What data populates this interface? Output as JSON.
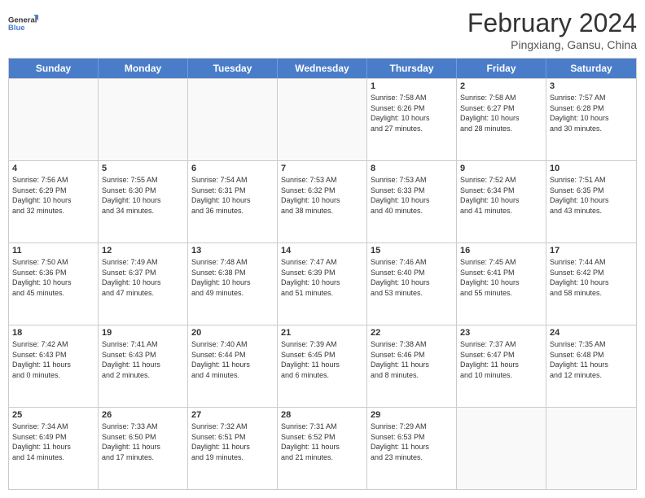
{
  "logo": {
    "line1": "General",
    "line2": "Blue"
  },
  "title": "February 2024",
  "subtitle": "Pingxiang, Gansu, China",
  "headers": [
    "Sunday",
    "Monday",
    "Tuesday",
    "Wednesday",
    "Thursday",
    "Friday",
    "Saturday"
  ],
  "weeks": [
    [
      {
        "day": "",
        "info": ""
      },
      {
        "day": "",
        "info": ""
      },
      {
        "day": "",
        "info": ""
      },
      {
        "day": "",
        "info": ""
      },
      {
        "day": "1",
        "info": "Sunrise: 7:58 AM\nSunset: 6:26 PM\nDaylight: 10 hours\nand 27 minutes."
      },
      {
        "day": "2",
        "info": "Sunrise: 7:58 AM\nSunset: 6:27 PM\nDaylight: 10 hours\nand 28 minutes."
      },
      {
        "day": "3",
        "info": "Sunrise: 7:57 AM\nSunset: 6:28 PM\nDaylight: 10 hours\nand 30 minutes."
      }
    ],
    [
      {
        "day": "4",
        "info": "Sunrise: 7:56 AM\nSunset: 6:29 PM\nDaylight: 10 hours\nand 32 minutes."
      },
      {
        "day": "5",
        "info": "Sunrise: 7:55 AM\nSunset: 6:30 PM\nDaylight: 10 hours\nand 34 minutes."
      },
      {
        "day": "6",
        "info": "Sunrise: 7:54 AM\nSunset: 6:31 PM\nDaylight: 10 hours\nand 36 minutes."
      },
      {
        "day": "7",
        "info": "Sunrise: 7:53 AM\nSunset: 6:32 PM\nDaylight: 10 hours\nand 38 minutes."
      },
      {
        "day": "8",
        "info": "Sunrise: 7:53 AM\nSunset: 6:33 PM\nDaylight: 10 hours\nand 40 minutes."
      },
      {
        "day": "9",
        "info": "Sunrise: 7:52 AM\nSunset: 6:34 PM\nDaylight: 10 hours\nand 41 minutes."
      },
      {
        "day": "10",
        "info": "Sunrise: 7:51 AM\nSunset: 6:35 PM\nDaylight: 10 hours\nand 43 minutes."
      }
    ],
    [
      {
        "day": "11",
        "info": "Sunrise: 7:50 AM\nSunset: 6:36 PM\nDaylight: 10 hours\nand 45 minutes."
      },
      {
        "day": "12",
        "info": "Sunrise: 7:49 AM\nSunset: 6:37 PM\nDaylight: 10 hours\nand 47 minutes."
      },
      {
        "day": "13",
        "info": "Sunrise: 7:48 AM\nSunset: 6:38 PM\nDaylight: 10 hours\nand 49 minutes."
      },
      {
        "day": "14",
        "info": "Sunrise: 7:47 AM\nSunset: 6:39 PM\nDaylight: 10 hours\nand 51 minutes."
      },
      {
        "day": "15",
        "info": "Sunrise: 7:46 AM\nSunset: 6:40 PM\nDaylight: 10 hours\nand 53 minutes."
      },
      {
        "day": "16",
        "info": "Sunrise: 7:45 AM\nSunset: 6:41 PM\nDaylight: 10 hours\nand 55 minutes."
      },
      {
        "day": "17",
        "info": "Sunrise: 7:44 AM\nSunset: 6:42 PM\nDaylight: 10 hours\nand 58 minutes."
      }
    ],
    [
      {
        "day": "18",
        "info": "Sunrise: 7:42 AM\nSunset: 6:43 PM\nDaylight: 11 hours\nand 0 minutes."
      },
      {
        "day": "19",
        "info": "Sunrise: 7:41 AM\nSunset: 6:43 PM\nDaylight: 11 hours\nand 2 minutes."
      },
      {
        "day": "20",
        "info": "Sunrise: 7:40 AM\nSunset: 6:44 PM\nDaylight: 11 hours\nand 4 minutes."
      },
      {
        "day": "21",
        "info": "Sunrise: 7:39 AM\nSunset: 6:45 PM\nDaylight: 11 hours\nand 6 minutes."
      },
      {
        "day": "22",
        "info": "Sunrise: 7:38 AM\nSunset: 6:46 PM\nDaylight: 11 hours\nand 8 minutes."
      },
      {
        "day": "23",
        "info": "Sunrise: 7:37 AM\nSunset: 6:47 PM\nDaylight: 11 hours\nand 10 minutes."
      },
      {
        "day": "24",
        "info": "Sunrise: 7:35 AM\nSunset: 6:48 PM\nDaylight: 11 hours\nand 12 minutes."
      }
    ],
    [
      {
        "day": "25",
        "info": "Sunrise: 7:34 AM\nSunset: 6:49 PM\nDaylight: 11 hours\nand 14 minutes."
      },
      {
        "day": "26",
        "info": "Sunrise: 7:33 AM\nSunset: 6:50 PM\nDaylight: 11 hours\nand 17 minutes."
      },
      {
        "day": "27",
        "info": "Sunrise: 7:32 AM\nSunset: 6:51 PM\nDaylight: 11 hours\nand 19 minutes."
      },
      {
        "day": "28",
        "info": "Sunrise: 7:31 AM\nSunset: 6:52 PM\nDaylight: 11 hours\nand 21 minutes."
      },
      {
        "day": "29",
        "info": "Sunrise: 7:29 AM\nSunset: 6:53 PM\nDaylight: 11 hours\nand 23 minutes."
      },
      {
        "day": "",
        "info": ""
      },
      {
        "day": "",
        "info": ""
      }
    ]
  ]
}
